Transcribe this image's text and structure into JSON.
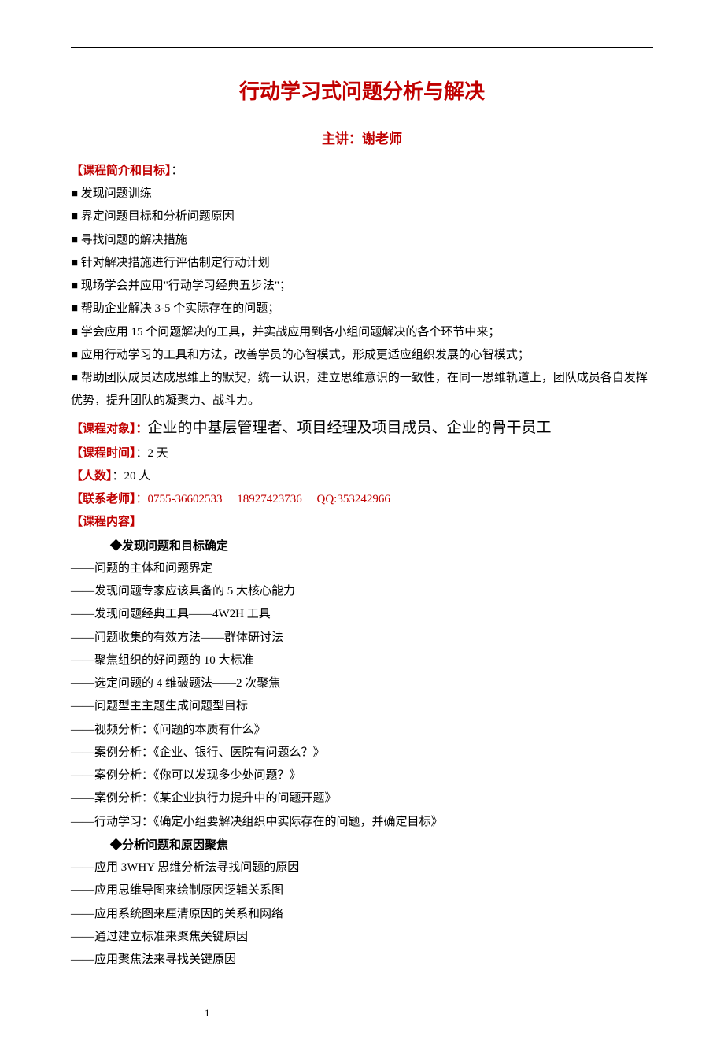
{
  "title": "行动学习式问题分析与解决",
  "lecturer_prefix": "主讲：",
  "lecturer_name": "谢老师",
  "sections": {
    "intro_label": "【课程简介和目标】",
    "colon": "：",
    "bullets": [
      "■ 发现问题训练",
      "■ 界定问题目标和分析问题原因",
      "■ 寻找问题的解决措施",
      "■ 针对解决措施进行评估制定行动计划",
      "■ 现场学会并应用\"行动学习经典五步法\"；",
      "■ 帮助企业解决 3-5 个实际存在的问题；",
      "■ 学会应用 15 个问题解决的工具，并实战应用到各小组问题解决的各个环节中来；",
      "■ 应用行动学习的工具和方法，改善学员的心智模式，形成更适应组织发展的心智模式；",
      "■ 帮助团队成员达成思维上的默契，统一认识，建立思维意识的一致性，在同一思维轨道上，团队成员各自发挥优势，提升团队的凝聚力、战斗力。"
    ],
    "audience_label": "【课程对象】：",
    "audience_value": "企业的中基层管理者、项目经理及项目成员、企业的骨干员工",
    "time_label": "【课程时间】",
    "time_value": "：2 天",
    "people_label": "【人数】",
    "people_value": "：20 人",
    "contact_label": "【联系老师】",
    "contact_value": "：0755-36602533  18927423736  QQ:353242966",
    "content_label": "【课程内容】",
    "sub1": "◆发现问题和目标确定",
    "items1": [
      "——问题的主体和问题界定",
      "——发现问题专家应该具备的 5 大核心能力",
      "——发现问题经典工具——4W2H 工具",
      "——问题收集的有效方法——群体研讨法",
      "——聚焦组织的好问题的 10 大标准",
      "——选定问题的 4 维破题法——2 次聚焦",
      "——问题型主主题生成问题型目标",
      "——视频分析：《问题的本质有什么》",
      "——案例分析：《企业、银行、医院有问题么？》",
      "——案例分析：《你可以发现多少处问题？》",
      "——案例分析：《某企业执行力提升中的问题开题》",
      "——行动学习：《确定小组要解决组织中实际存在的问题，并确定目标》"
    ],
    "sub2": "◆分析问题和原因聚焦",
    "items2": [
      "——应用 3WHY 思维分析法寻找问题的原因",
      "——应用思维导图来绘制原因逻辑关系图",
      "——应用系统图来厘清原因的关系和网络",
      "——通过建立标准来聚焦关键原因",
      "——应用聚焦法来寻找关键原因"
    ]
  },
  "page_number": "1"
}
